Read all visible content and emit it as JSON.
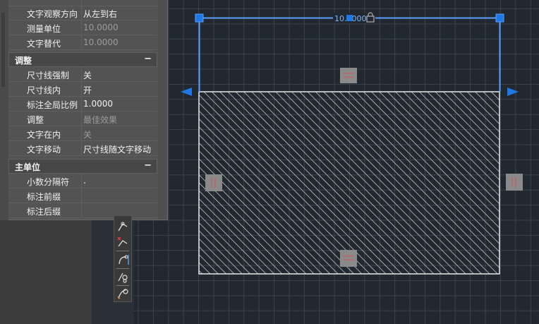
{
  "dimension": {
    "text": "10.0000",
    "lock_icon": "lock-icon"
  },
  "properties": {
    "top_rows": [
      {
        "key": "文字观察方向",
        "value": "从左到右",
        "dim": false
      },
      {
        "key": "测量单位",
        "value": "10.0000",
        "dim": true
      },
      {
        "key": "文字替代",
        "value": "10.0000",
        "dim": true
      }
    ],
    "sections": [
      {
        "title": "调整",
        "collapse": "−",
        "rows": [
          {
            "key": "尺寸线强制",
            "value": "关",
            "dim": false
          },
          {
            "key": "尺寸线内",
            "value": "开",
            "dim": false
          },
          {
            "key": "标注全局比例",
            "value": "1.0000",
            "dim": false
          },
          {
            "key": "调整",
            "value": "最佳效果",
            "dim": true
          },
          {
            "key": "文字在内",
            "value": "关",
            "dim": true
          },
          {
            "key": "文字移动",
            "value": "尺寸线随文字移动",
            "dim": false
          }
        ]
      },
      {
        "title": "主单位",
        "collapse": "−",
        "rows": [
          {
            "key": "小数分隔符",
            "value": ".",
            "dim": false
          },
          {
            "key": "标注前缀",
            "value": "",
            "dim": false
          },
          {
            "key": "标注后缀",
            "value": "",
            "dim": false
          }
        ]
      }
    ]
  },
  "toolbar_icons": [
    "snap-tool-1-icon",
    "snap-tool-2-icon",
    "snap-tool-3-icon",
    "snap-tool-4-icon",
    "snap-tool-5-icon"
  ],
  "colors": {
    "grip_blue": "#1e78e6",
    "dimension_line": "#5aa0ff",
    "hatch": "#e8e8e8",
    "canvas_bg": "#212830"
  }
}
